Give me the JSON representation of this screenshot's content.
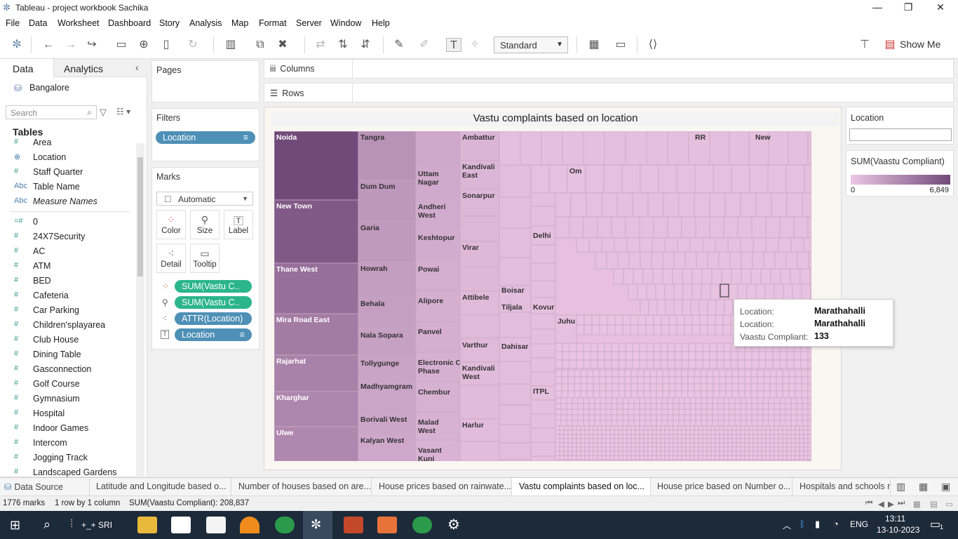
{
  "window": {
    "title": "Tableau - project workbook Sachika",
    "controls": [
      "—",
      "❐",
      "✕"
    ]
  },
  "menu": [
    "File",
    "Data",
    "Worksheet",
    "Dashboard",
    "Story",
    "Analysis",
    "Map",
    "Format",
    "Server",
    "Window",
    "Help"
  ],
  "toolbar": {
    "fit_mode": "Standard",
    "show_me": "Show Me"
  },
  "data_pane": {
    "tab_data": "Data",
    "tab_analytics": "Analytics",
    "datasource": "Bangalore",
    "search_placeholder": "Search",
    "tables_heading": "Tables",
    "fields": [
      {
        "icon": "#",
        "name": "Area"
      },
      {
        "icon": "⊕",
        "name": "Location"
      },
      {
        "icon": "#",
        "name": "Staff Quarter"
      },
      {
        "icon": "Abc",
        "name": "Table Name"
      },
      {
        "icon": "Abc",
        "name": "Measure Names"
      },
      {
        "icon": "=#",
        "name": "0"
      },
      {
        "icon": "#",
        "name": "24X7Security"
      },
      {
        "icon": "#",
        "name": "AC"
      },
      {
        "icon": "#",
        "name": "ATM"
      },
      {
        "icon": "#",
        "name": "BED"
      },
      {
        "icon": "#",
        "name": "Cafeteria"
      },
      {
        "icon": "#",
        "name": "Car Parking"
      },
      {
        "icon": "#",
        "name": "Children'splayarea"
      },
      {
        "icon": "#",
        "name": "Club House"
      },
      {
        "icon": "#",
        "name": "Dining Table"
      },
      {
        "icon": "#",
        "name": "Gasconnection"
      },
      {
        "icon": "#",
        "name": "Golf Course"
      },
      {
        "icon": "#",
        "name": "Gymnasium"
      },
      {
        "icon": "#",
        "name": "Hospital"
      },
      {
        "icon": "#",
        "name": "Indoor Games"
      },
      {
        "icon": "#",
        "name": "Intercom"
      },
      {
        "icon": "#",
        "name": "Jogging Track"
      },
      {
        "icon": "#",
        "name": "Landscaped Gardens"
      }
    ]
  },
  "pages": {
    "label": "Pages"
  },
  "filters": {
    "label": "Filters",
    "pill": "Location"
  },
  "marks": {
    "label": "Marks",
    "type": "Automatic",
    "buttons": [
      "Color",
      "Size",
      "Label",
      "Detail",
      "Tooltip"
    ],
    "pills": [
      {
        "kind": "color",
        "text": "SUM(Vastu C..",
        "style": "green"
      },
      {
        "kind": "size",
        "text": "SUM(Vastu C..",
        "style": "green"
      },
      {
        "kind": "detail",
        "text": "ATTR(Location)",
        "style": "blue"
      },
      {
        "kind": "label",
        "text": "Location",
        "style": "blue"
      }
    ]
  },
  "shelves": {
    "columns": "Columns",
    "rows": "Rows"
  },
  "viz": {
    "title": "Vastu complaints based on location"
  },
  "chart_data": {
    "type": "treemap",
    "title": "Vastu complaints based on location",
    "measure": "SUM(Vaastu Compliant)",
    "labels": [
      "Noida",
      "New Town",
      "Thane West",
      "Mira Road East",
      "Rajarhat",
      "Kharghar",
      "Ulwe",
      "Tangra",
      "Dum Dum",
      "Garia",
      "Howrah",
      "Behala",
      "Nala Sopara",
      "Tollygunge",
      "Madhyamgram",
      "Borivali West",
      "Kalyan West",
      "Uttam Nagar",
      "Andheri West",
      "Keshtopur",
      "Powai",
      "Alipore",
      "Panvel",
      "Electronic City Phase",
      "Chembur",
      "Malad West",
      "Vasant Kunj",
      "Ambattur",
      "Kandivali East",
      "Sonarpur",
      "Virar",
      "Attibele",
      "Varthur",
      "Kandivali West",
      "Harlur",
      "Boisar",
      "Tiljala",
      "Dahisar",
      "Delhi",
      "Kovur",
      "ITPL",
      "Om",
      "Juhu",
      "RR",
      "New"
    ],
    "color_range": [
      0,
      6849
    ],
    "colors": [
      "#ecc6e4",
      "#724a7a"
    ]
  },
  "tooltip": {
    "rows": [
      {
        "key": "Location:",
        "value": "Marathahalli"
      },
      {
        "key": "Location:",
        "value": "Marathahalli"
      },
      {
        "key": "Vaastu Compliant:",
        "value": "133"
      }
    ]
  },
  "legend": {
    "location_title": "Location",
    "color_title": "SUM(Vaastu Compliant)",
    "min": "0",
    "max": "6,849"
  },
  "sheet_tabs": [
    "Data Source",
    "Latitude and Longitude based o...",
    "Number of houses based on are...",
    "House prices based on rainwate...",
    "Vastu complaints based on loc...",
    "House price based on Number o...",
    "Hospitals and schools n"
  ],
  "status": {
    "marks": "1776 marks",
    "dims": "1 row by 1 column",
    "sum": "SUM(Vaastu Compliant): 208,837"
  },
  "taskbar": {
    "search_app": "+_+ SRI",
    "lang": "ENG",
    "time": "13:11",
    "date": "13-10-2023",
    "notif": "1"
  }
}
